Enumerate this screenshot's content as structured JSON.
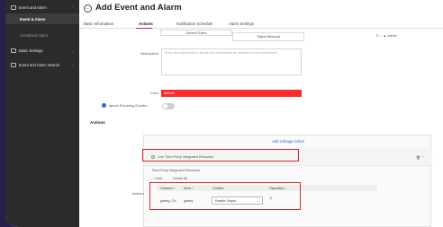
{
  "sidebar": {
    "items": [
      {
        "label": "Event and Alarm"
      },
      {
        "label": "Event & Alarm"
      },
      {
        "label": "Combined Alarm"
      },
      {
        "label": "Basic Settings"
      },
      {
        "label": "Event and Alarm Search"
      }
    ]
  },
  "header": {
    "title": "Add Event and Alarm",
    "back_icon": "back-arrow-icon"
  },
  "tabs": [
    {
      "label": "Basic Information"
    },
    {
      "label": "Actions"
    },
    {
      "label": "Notification Schedule"
    },
    {
      "label": "Alarm Settings"
    }
  ],
  "top_table": {
    "cells": [
      "Generic Event",
      "Object Removal"
    ],
    "right_text": "E ⌵ ▲ admin"
  },
  "form": {
    "description_label": "Description",
    "description_placeholder": "Enter the instructions to handle the event/alarm as remarks for the event/alarm.",
    "color_label": "Color",
    "color_value": "#ff0000",
    "ignore_label": "Ignore Recurring Events/..."
  },
  "actions": {
    "section_title": "Actions",
    "add_linkage": "Add Linkage Action",
    "link_resource": "Link Third-Party Integrated Resource",
    "resource_title": "Third-Party Integrated Resource",
    "add_label": "+ Add",
    "delete_label": "Delete All",
    "row_label": "Actions",
    "columns": [
      "Camera ↕",
      "Area ↕",
      "Control",
      "Operation"
    ],
    "row": {
      "camera": "galaxy_Ch...",
      "area": "galaxy",
      "control": "Enable Output"
    }
  },
  "colors": {
    "accent_red": "#e0232b",
    "link_blue": "#2e6ccf",
    "sidebar_bg": "#2b2b2b"
  }
}
